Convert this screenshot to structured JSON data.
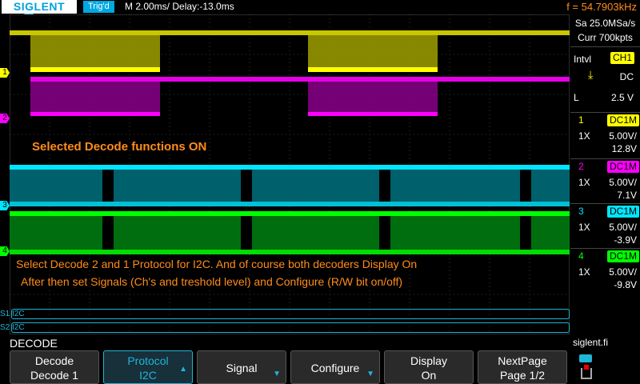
{
  "header": {
    "brand": "SIGLENT",
    "trig_status": "Trig'd",
    "timebase": "M 2.00ms/ Delay:-13.0ms",
    "frequency": "f = 54.7903kHz"
  },
  "acquisition": {
    "sample_rate": "Sa 25.0MSa/s",
    "memory": "Curr 700kpts"
  },
  "trigger": {
    "mode": "Intvl",
    "source": "CH1",
    "coupling": "DC",
    "slope_label": "L",
    "level": "2.5 V"
  },
  "channels": [
    {
      "num": "1",
      "coupling": "DC1M",
      "probe": "1X",
      "scale": "5.00V/",
      "offset": "12.8V",
      "color": "#ffff00"
    },
    {
      "num": "2",
      "coupling": "DC1M",
      "probe": "1X",
      "scale": "5.00V/",
      "offset": "7.1V",
      "color": "#ff00ff"
    },
    {
      "num": "3",
      "coupling": "DC1M",
      "probe": "1X",
      "scale": "5.00V/",
      "offset": "-3.9V",
      "color": "#00e5ff"
    },
    {
      "num": "4",
      "coupling": "DC1M",
      "probe": "1X",
      "scale": "5.00V/",
      "offset": "-9.8V",
      "color": "#00ff00"
    }
  ],
  "notes": {
    "note1": "Selected Decode functions ON",
    "note2": "Select Decode 2 and 1 Protocol for I2C.    And of course both decoders Display On",
    "note3": "After then set Signals (Ch's and treshold level) and Configure (R/W bit on/off)"
  },
  "decode_bars": [
    {
      "label": "S1",
      "protocol": "I2C"
    },
    {
      "label": "S2",
      "protocol": "I2C"
    }
  ],
  "menu": {
    "title": "DECODE",
    "site": "siglent.fi",
    "buttons": [
      {
        "line1": "Decode",
        "line2": "Decode 1"
      },
      {
        "line1": "Protocol",
        "line2": "I2C"
      },
      {
        "line1": "Signal",
        "line2": ""
      },
      {
        "line1": "Configure",
        "line2": ""
      },
      {
        "line1": "Display",
        "line2": "On"
      },
      {
        "line1": "NextPage",
        "line2": "Page 1/2"
      }
    ]
  }
}
